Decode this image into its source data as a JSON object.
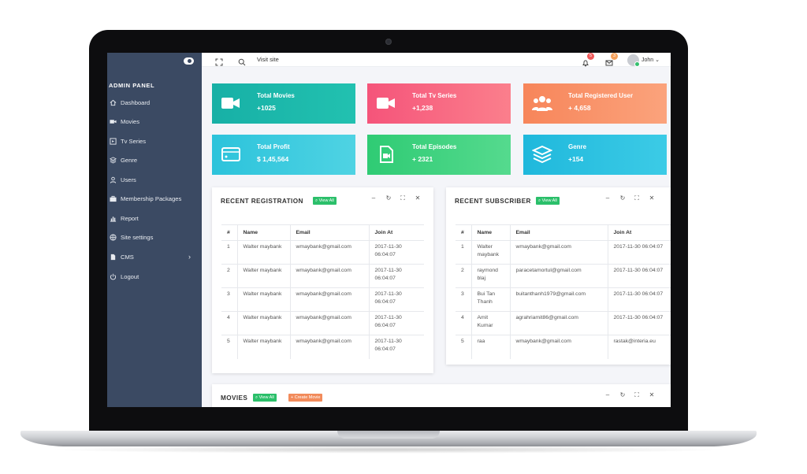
{
  "sidebar": {
    "title": "ADMIN PANEL",
    "items": [
      {
        "label": "Dashboard",
        "icon": "home-icon"
      },
      {
        "label": "Movies",
        "icon": "video-icon"
      },
      {
        "label": "Tv Series",
        "icon": "film-icon"
      },
      {
        "label": "Genre",
        "icon": "layers-icon"
      },
      {
        "label": "Users",
        "icon": "user-icon"
      },
      {
        "label": "Membership Packages",
        "icon": "briefcase-icon"
      },
      {
        "label": "Report",
        "icon": "chart-icon"
      },
      {
        "label": "Site settings",
        "icon": "globe-icon"
      },
      {
        "label": "CMS",
        "icon": "file-icon"
      },
      {
        "label": "Logout",
        "icon": "power-icon"
      }
    ]
  },
  "topbar": {
    "visit_site": "Visit site",
    "notifications_count": "5",
    "messages_count": "3",
    "user_name": "John"
  },
  "stats": [
    {
      "title": "Total Movies",
      "value": "+1025",
      "color": "#1bb3a8",
      "icon": "video-camera-icon"
    },
    {
      "title": "Total Tv Series",
      "value": "+1,238",
      "color": "#f5607a",
      "icon": "video-camera-icon"
    },
    {
      "title": "Total Registered User",
      "value": "+ 4,658",
      "color": "#f69366",
      "icon": "users-icon"
    },
    {
      "title": "Total Profit",
      "value": "$ 1,45,564",
      "color": "#3cc7dd",
      "icon": "wallet-icon"
    },
    {
      "title": "Total Episodes",
      "value": "+ 2321",
      "color": "#35cf7c",
      "icon": "video-file-icon"
    },
    {
      "title": "Genre",
      "value": "+154",
      "color": "#29c2e0",
      "icon": "layers-icon"
    }
  ],
  "recent_registration": {
    "title": "RECENT REGISTRATION",
    "view_all": "View All",
    "columns": [
      "#",
      "Name",
      "Email",
      "Join At"
    ],
    "rows": [
      [
        "1",
        "Walter maybank",
        "wmaybank@gmail.com",
        "2017-11-30 06:04:07"
      ],
      [
        "2",
        "Walter maybank",
        "wmaybank@gmail.com",
        "2017-11-30 06:04:07"
      ],
      [
        "3",
        "Walter maybank",
        "wmaybank@gmail.com",
        "2017-11-30 06:04:07"
      ],
      [
        "4",
        "Walter maybank",
        "wmaybank@gmail.com",
        "2017-11-30 06:04:07"
      ],
      [
        "5",
        "Walter maybank",
        "wmaybank@gmail.com",
        "2017-11-30 06:04:07"
      ]
    ]
  },
  "recent_subscriber": {
    "title": "RECENT SUBSCRIBER",
    "view_all": "View All",
    "columns": [
      "#",
      "Name",
      "Email",
      "Join At"
    ],
    "rows": [
      [
        "1",
        "Walter maybank",
        "wmaybank@gmail.com",
        "2017-11-30 06:04:07"
      ],
      [
        "2",
        "raymond blaj",
        "paracetamortul@gmail.com",
        "2017-11-30 06:04:07"
      ],
      [
        "3",
        "Bui Tan Thanh",
        "buitanthanh1979@gmail.com",
        "2017-11-30 06:04:07"
      ],
      [
        "4",
        "Amit Kumar",
        "agrahriamit86@gmail.com",
        "2017-11-30 06:04:07"
      ],
      [
        "5",
        "raa",
        "wmaybank@gmail.com",
        "rastak@interia.eu"
      ]
    ]
  },
  "movies_panel": {
    "title": "MOVIES",
    "view_all": "View All",
    "create": "+ Create Movie"
  },
  "panel_controls": [
    "–",
    "↻",
    "⛶",
    "✕"
  ]
}
